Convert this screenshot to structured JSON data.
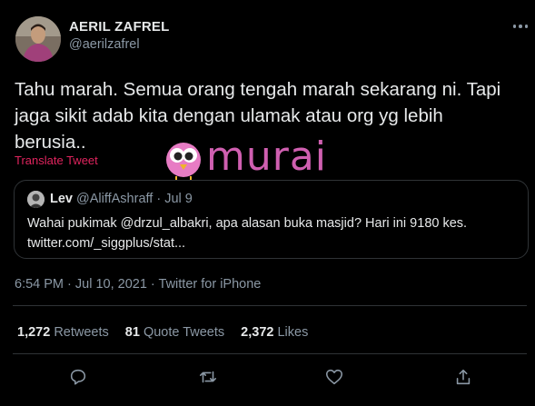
{
  "author": {
    "display_name": "AERIL ZAFREL",
    "handle": "@aerilzafrel"
  },
  "tweet": {
    "text": "Tahu marah. Semua orang tengah marah sekarang ni. Tapi jaga sikit adab kita dengan ulamak atau org yg lebih berusia..",
    "translate_label": "Translate Tweet"
  },
  "watermark": {
    "text": "murai"
  },
  "quoted_tweet": {
    "name": "Lev",
    "handle_date": "@AliffAshraff · Jul 9",
    "text_line1": "Wahai pukimak @drzul_albakri, apa alasan buka masjid? Hari ini 9180 kes.",
    "text_line2": "twitter.com/_siggplus/stat..."
  },
  "meta": {
    "timestamp_source": "6:54 PM · Jul 10, 2021 · Twitter for iPhone"
  },
  "stats": {
    "retweets_count": "1,272",
    "retweets_label": "Retweets",
    "quotes_count": "81",
    "quotes_label": "Quote Tweets",
    "likes_count": "2,372",
    "likes_label": "Likes"
  },
  "icons": {
    "more": "more-icon",
    "reply": "reply-icon",
    "retweet": "retweet-icon",
    "like": "heart-icon",
    "share": "share-icon"
  },
  "colors": {
    "background": "#000000",
    "text": "#e7e9ea",
    "secondary": "#8b98a5",
    "translate_link": "#e0245e",
    "watermark": "#cf5fb0"
  }
}
